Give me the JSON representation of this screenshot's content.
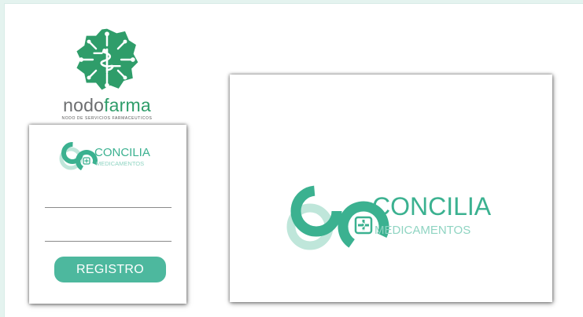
{
  "brand": {
    "word_part1": "nodo",
    "word_part2": "farma",
    "tagline": "NODO DE SERVICIOS FARMACEUTICOS",
    "symbol_icon": "nodofarma-gear-caduceus-icon",
    "colors": {
      "green": "#2f9d6a",
      "gray": "#6c6e70"
    }
  },
  "login": {
    "logo_title": "CONCILIA",
    "logo_subtitle": "MEDICAMENTOS",
    "field1_value": "",
    "field2_value": "",
    "register_label": "REGISTRO"
  },
  "preview": {
    "logo_title": "CONCILIA",
    "logo_subtitle": "MEDICAMENTOS"
  },
  "colors": {
    "teal": "#3bb190",
    "teal_light": "#bfe6da",
    "button": "#4db89e",
    "background": "#e4f3ef"
  }
}
